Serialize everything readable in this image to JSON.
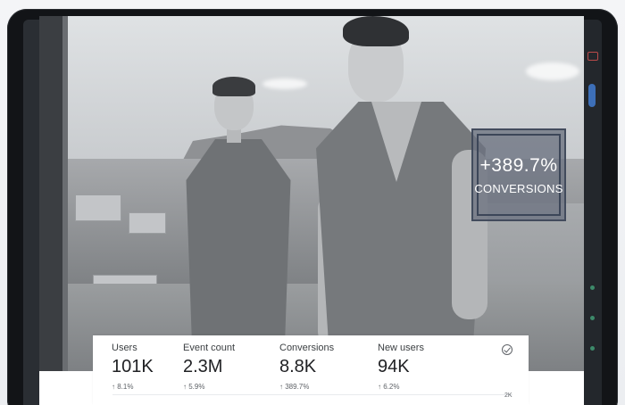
{
  "callout": {
    "value": "+389.7%",
    "label": "CONVERSIONS"
  },
  "metrics": [
    {
      "label": "Users",
      "value": "101K",
      "change": "↑ 8.1%"
    },
    {
      "label": "Event count",
      "value": "2.3M",
      "change": "↑ 5.9%"
    },
    {
      "label": "Conversions",
      "value": "8.8K",
      "change": "↑ 389.7%"
    },
    {
      "label": "New users",
      "value": "94K",
      "change": "↑ 6.2%"
    }
  ],
  "chart": {
    "y_tick": "2K"
  },
  "icons": {
    "status": "check-circle-icon"
  }
}
